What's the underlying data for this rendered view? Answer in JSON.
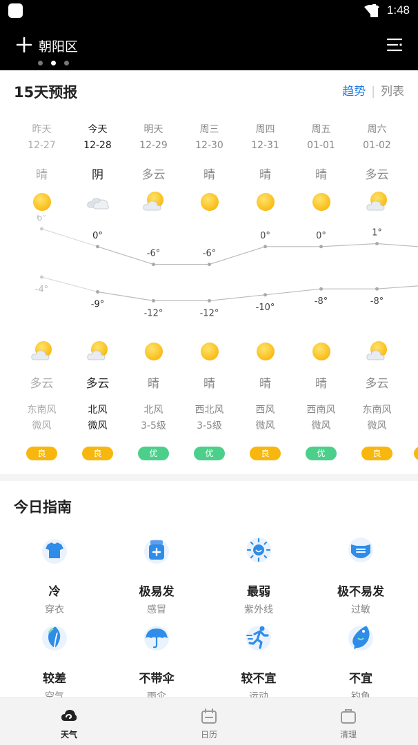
{
  "status": {
    "time": "1:48"
  },
  "header": {
    "city": "朝阳区"
  },
  "forecast": {
    "title": "15天预报",
    "tab_trend": "趋势",
    "tab_list": "列表",
    "days": [
      {
        "day": "昨天",
        "date": "12-27",
        "day_weather": "晴",
        "day_icon": "sun",
        "high": 6,
        "high_label": "6°",
        "low": -4,
        "low_label": "-4°",
        "night_icon": "sun-cloud",
        "night_weather": "多云",
        "wind_dir": "东南风",
        "wind_level": "微风",
        "aqi": "良",
        "state": "past"
      },
      {
        "day": "今天",
        "date": "12-28",
        "day_weather": "阴",
        "day_icon": "cloud",
        "high": 0,
        "high_label": "0°",
        "low": -9,
        "low_label": "-9°",
        "night_icon": "sun-cloud",
        "night_weather": "多云",
        "wind_dir": "北风",
        "wind_level": "微风",
        "aqi": "良",
        "state": "cur"
      },
      {
        "day": "明天",
        "date": "12-29",
        "day_weather": "多云",
        "day_icon": "sun-cloud",
        "high": -6,
        "high_label": "-6°",
        "low": -12,
        "low_label": "-12°",
        "night_icon": "sun",
        "night_weather": "晴",
        "wind_dir": "北风",
        "wind_level": "3-5级",
        "aqi": "优",
        "state": "fut"
      },
      {
        "day": "周三",
        "date": "12-30",
        "day_weather": "晴",
        "day_icon": "sun",
        "high": -6,
        "high_label": "-6°",
        "low": -12,
        "low_label": "-12°",
        "night_icon": "sun",
        "night_weather": "晴",
        "wind_dir": "西北风",
        "wind_level": "3-5级",
        "aqi": "优",
        "state": "fut"
      },
      {
        "day": "周四",
        "date": "12-31",
        "day_weather": "晴",
        "day_icon": "sun",
        "high": 0,
        "high_label": "0°",
        "low": -10,
        "low_label": "-10°",
        "night_icon": "sun",
        "night_weather": "晴",
        "wind_dir": "西风",
        "wind_level": "微风",
        "aqi": "良",
        "state": "fut"
      },
      {
        "day": "周五",
        "date": "01-01",
        "day_weather": "晴",
        "day_icon": "sun",
        "high": 0,
        "high_label": "0°",
        "low": -8,
        "low_label": "-8°",
        "night_icon": "sun",
        "night_weather": "晴",
        "wind_dir": "西南风",
        "wind_level": "微风",
        "aqi": "优",
        "state": "fut"
      },
      {
        "day": "周六",
        "date": "01-02",
        "day_weather": "多云",
        "day_icon": "sun-cloud",
        "high": 1,
        "high_label": "1°",
        "low": -8,
        "low_label": "-8°",
        "night_icon": "sun-cloud",
        "night_weather": "多云",
        "wind_dir": "东南风",
        "wind_level": "微风",
        "aqi": "良",
        "state": "fut"
      }
    ]
  },
  "guide": {
    "title": "今日指南",
    "items": [
      {
        "main": "冷",
        "sub": "穿衣",
        "icon": "shirt-icon"
      },
      {
        "main": "极易发",
        "sub": "感冒",
        "icon": "medicine-icon"
      },
      {
        "main": "最弱",
        "sub": "紫外线",
        "icon": "uv-sun-icon"
      },
      {
        "main": "极不易发",
        "sub": "过敏",
        "icon": "mask-icon"
      },
      {
        "main": "较差",
        "sub": "空气",
        "icon": "leaf-icon"
      },
      {
        "main": "不带伞",
        "sub": "雨伞",
        "icon": "umbrella-icon"
      },
      {
        "main": "较不宜",
        "sub": "运动",
        "icon": "runner-icon"
      },
      {
        "main": "不宜",
        "sub": "钓鱼",
        "icon": "fish-icon"
      }
    ]
  },
  "nav": {
    "weather": "天气",
    "calendar": "日历",
    "clean": "清理"
  },
  "colors": {
    "aqi_good": "#f8b70e",
    "aqi_excellent": "#4ccf8a",
    "accent": "#1e7be6"
  }
}
